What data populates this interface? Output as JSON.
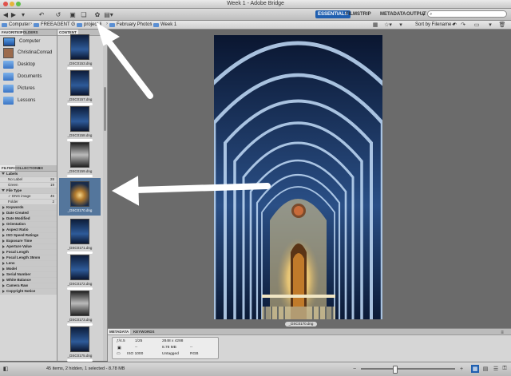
{
  "window": {
    "title": "Week 1 - Adobe Bridge"
  },
  "toolbar": {
    "workspaces": [
      "ESSENTIALS",
      "FILMSTRIP",
      "METADATA",
      "OUTPUT"
    ],
    "active_workspace": "ESSENTIALS",
    "search_placeholder": "",
    "sort_label": "Sort by Filename"
  },
  "path": {
    "crumbs": [
      "Computer",
      "FREEAGENT G",
      "project li",
      "February Photos",
      "Week 1"
    ]
  },
  "left_panel": {
    "tabs": [
      "FAVORITES",
      "FOLDERS"
    ],
    "favorites": [
      "Computer",
      "ChristinaConrad",
      "Desktop",
      "Documents",
      "Pictures",
      "Lessons"
    ],
    "filter_tabs": [
      "FILTER",
      "COLLECTIONS",
      "EX"
    ],
    "filters": [
      {
        "label": "Labels",
        "header": true,
        "open": true
      },
      {
        "label": "No Label",
        "count": "28"
      },
      {
        "label": "Green",
        "count": "19"
      },
      {
        "label": "File Type",
        "header": true,
        "open": true
      },
      {
        "label": "✓ DNG image",
        "count": "45"
      },
      {
        "label": "Folder",
        "count": "2"
      },
      {
        "label": "Keywords",
        "header": true
      },
      {
        "label": "Date Created",
        "header": true
      },
      {
        "label": "Date Modified",
        "header": true
      },
      {
        "label": "Orientation",
        "header": true
      },
      {
        "label": "Aspect Ratio",
        "header": true
      },
      {
        "label": "ISO Speed Ratings",
        "header": true
      },
      {
        "label": "Exposure Time",
        "header": true
      },
      {
        "label": "Aperture Value",
        "header": true
      },
      {
        "label": "Focal Length",
        "header": true
      },
      {
        "label": "Focal Length 35mm",
        "header": true
      },
      {
        "label": "Lens",
        "header": true
      },
      {
        "label": "Model",
        "header": true
      },
      {
        "label": "Serial Number",
        "header": true
      },
      {
        "label": "White Balance",
        "header": true
      },
      {
        "label": "Camera Raw",
        "header": true
      },
      {
        "label": "Copyright Notice",
        "header": true
      }
    ]
  },
  "content": {
    "tab": "CONTENT",
    "thumbs": [
      {
        "name": "_DSC0153.dng",
        "style": "dark"
      },
      {
        "name": "_DSC0157.dng",
        "style": "dark"
      },
      {
        "name": "_DSC0158.dng",
        "style": "dark"
      },
      {
        "name": "_DSC0159.dng",
        "style": "bw"
      },
      {
        "name": "_DSC0170.dng",
        "style": "warm",
        "selected": true
      },
      {
        "name": "_DSC0171.dng",
        "style": "dark"
      },
      {
        "name": "_DSC0172.dng",
        "style": "dark"
      },
      {
        "name": "_DSC0173.dng",
        "style": "bw"
      },
      {
        "name": "_DSC0175.dng",
        "style": "dark"
      }
    ]
  },
  "preview": {
    "caption": "_DSC0170.dng"
  },
  "metadata": {
    "tabs": [
      "METADATA",
      "KEYWORDS"
    ],
    "aperture": "ƒ/4.5",
    "shutter": "1/25",
    "dimensions": "2848 x 4288",
    "size": "8.78 MB",
    "profile": "Untagged",
    "color_mode": "RGB",
    "iso": "ISO 1000",
    "dash1": "--",
    "dash2": "--"
  },
  "status": {
    "text": "45 items, 2 hidden, 1 selected - 8.78 MB"
  },
  "colors": {
    "accent": "#1f5fb0",
    "selection": "#54769c",
    "panel": "#d6d6d6",
    "background": "#6b6b6b"
  }
}
